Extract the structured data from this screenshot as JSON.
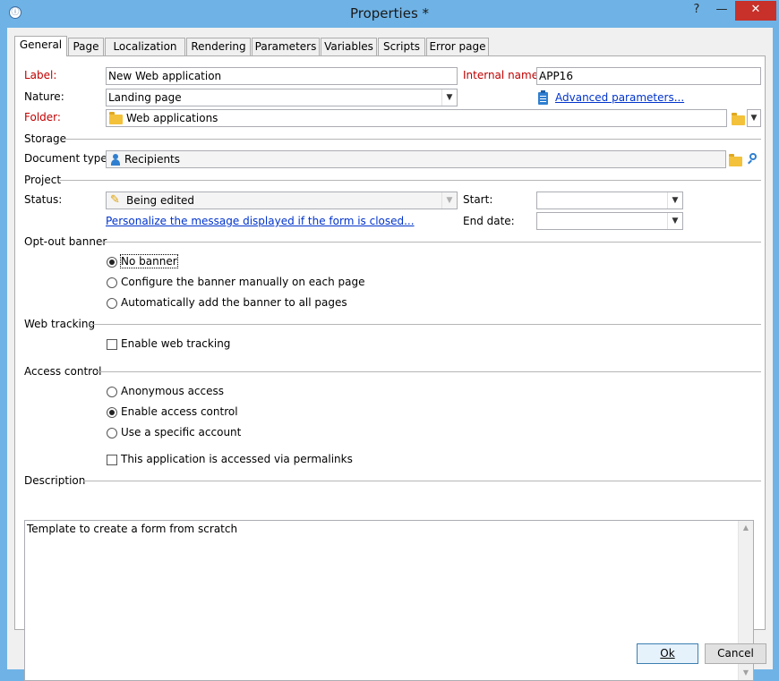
{
  "window": {
    "title": "Properties *",
    "help_glyph": "?",
    "minimize_glyph": "—",
    "close_glyph": "✕",
    "app_icon": "app-icon"
  },
  "tabs": [
    {
      "label": "General"
    },
    {
      "label": "Page"
    },
    {
      "label": "Localization"
    },
    {
      "label": "Rendering"
    },
    {
      "label": "Parameters"
    },
    {
      "label": "Variables"
    },
    {
      "label": "Scripts"
    },
    {
      "label": "Error page"
    }
  ],
  "form": {
    "label_label": "Label:",
    "label_value": "New Web application",
    "internal_name_label": "Internal name:",
    "internal_name_value": "APP16",
    "nature_label": "Nature:",
    "nature_value": "Landing page",
    "advanced_link": "Advanced parameters...",
    "folder_label": "Folder:",
    "folder_value": "Web applications"
  },
  "storage": {
    "section": "Storage",
    "doc_type_label": "Document type:",
    "doc_type_value": "Recipients"
  },
  "project": {
    "section": "Project",
    "status_label": "Status:",
    "status_value": "Being edited",
    "personalize_link": "Personalize the message displayed if the form is closed...",
    "start_label": "Start:",
    "start_value": "",
    "end_label": "End date:",
    "end_value": ""
  },
  "optout": {
    "section": "Opt-out banner",
    "options": [
      {
        "label": "No banner",
        "selected": true
      },
      {
        "label": "Configure the banner manually on each page",
        "selected": false
      },
      {
        "label": "Automatically add the banner to all pages",
        "selected": false
      }
    ]
  },
  "tracking": {
    "section": "Web tracking",
    "enable_label": "Enable web tracking"
  },
  "access": {
    "section": "Access control",
    "options": [
      {
        "label": "Anonymous access",
        "selected": false
      },
      {
        "label": "Enable access control",
        "selected": true
      },
      {
        "label": "Use a specific account",
        "selected": false
      }
    ],
    "permalinks_label": "This application is accessed via permalinks"
  },
  "description": {
    "section": "Description",
    "text": "Template to create a form from scratch"
  },
  "buttons": {
    "ok": "Ok",
    "cancel": "Cancel"
  },
  "icons": {
    "dropdown": "chevron-down-icon",
    "folder": "folder-icon",
    "user": "user-icon",
    "pencil": "pencil-icon",
    "search": "search-icon",
    "clipboard": "clipboard-icon"
  }
}
